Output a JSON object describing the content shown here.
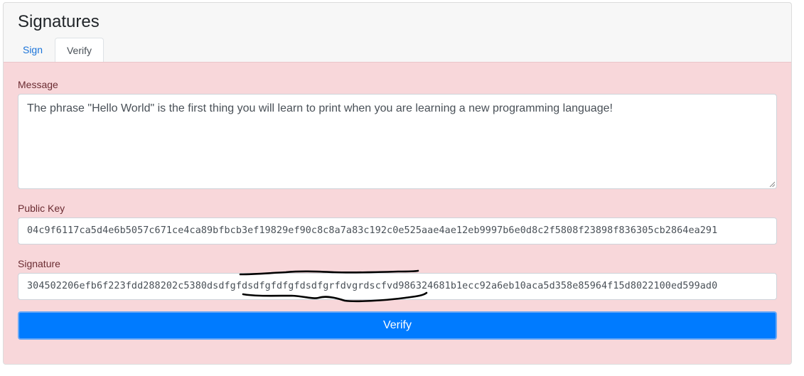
{
  "card": {
    "title": "Signatures"
  },
  "tabs": [
    {
      "label": "Sign",
      "active": false
    },
    {
      "label": "Verify",
      "active": true
    }
  ],
  "form": {
    "message_label": "Message",
    "message_value": "The phrase \"Hello World\" is the first thing you will learn to print when you are learning a new programming language!",
    "public_key_label": "Public Key",
    "public_key_value": "04c9f6117ca5d4e6b5057c671ce4ca89bfbcb3ef19829ef90c8c8a7a83c192c0e525aae4ae12eb9997b6e0d8c2f5808f23898f836305cb2864ea291",
    "signature_label": "Signature",
    "signature_value": "304502206efb6f223fdd288202c5380dsdfgfdsdfgfdfgfdsdfgrfdvgrdscfvd986324681b1ecc92a6eb10aca5d358e85964f15d8022100ed599ad0",
    "verify_label": "Verify"
  },
  "colors": {
    "panel_bg": "#f8d7da",
    "label_text": "#6b2c32",
    "button_bg": "#007bff",
    "link": "#1a73d9"
  },
  "annotations": {
    "signature_scribble": "hand-drawn black underline/overline marking part of the signature"
  }
}
